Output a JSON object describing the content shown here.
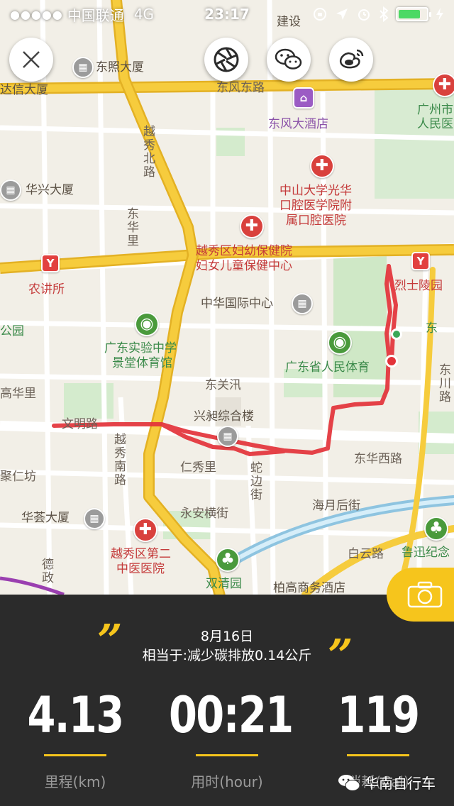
{
  "status_bar": {
    "signal": "●●●●●",
    "carrier": "中国联通",
    "network": "4G",
    "time": "23:17"
  },
  "map": {
    "labels": {
      "jianshe": "建设",
      "dongzhao": "东照大厦",
      "daxin": "达信大厦",
      "dongfeng_road": "东风东路",
      "dongfeng_hotel": "东风大酒店",
      "gz_city": "广州市",
      "people_court": "人民医",
      "yuexiu_north": "越秀北路",
      "huaxing": "华兴大厦",
      "zhongshan_1": "中山大学光华",
      "zhongshan_2": "口腔医学院附",
      "zhongshan_3": "属口腔医院",
      "donghua": "东华里",
      "maternity_1": "越秀区妇幼保健院",
      "maternity_2": "妇女儿童保健中心",
      "nongjiang": "农讲所",
      "martyrs": "烈士陵园",
      "zhonghua": "中华国际中心",
      "gongyuan": "公园",
      "dong": "东",
      "gd_exp_1": "广东实验中学",
      "gd_exp_2": "景堂体育馆",
      "gd_stadium": "广东省人民体育",
      "dongguan": "东关汛",
      "huali": "高华里",
      "wenming": "文明路",
      "xingzu": "兴昶综合楼",
      "yuexiu_south": "越秀南路",
      "dongchuan": "东川路",
      "donghua_west": "东华西路",
      "jiangren": "聚仁坊",
      "renxiu": "仁秀里",
      "dongdian": "东",
      "duobian": "蛇边街",
      "huaying": "华荟大厦",
      "yongan": "永安横街",
      "haiyue": "海月后街",
      "hospital2_1": "越秀区第二",
      "hospital2_2": "中医医院",
      "baiyun": "白云路",
      "luxun": "鲁迅纪念",
      "shuangqing": "双清园",
      "debo": "德政",
      "hotel_bottom": "柏高商务酒店"
    }
  },
  "controls": {
    "close": "close",
    "aperture": "aperture",
    "wechat": "wechat",
    "weibo": "weibo",
    "camera": "camera"
  },
  "summary": {
    "date": "8月16日",
    "text": "相当于:减少碳排放0.14公斤"
  },
  "stats": {
    "distance": {
      "value": "4.13",
      "label": "里程(km)"
    },
    "duration": {
      "value": "00:21",
      "label": "用时(hour)"
    },
    "calories": {
      "value": "119",
      "label": "消耗(Cal)"
    }
  },
  "watermark": {
    "text": "华南自行车"
  },
  "colors": {
    "accent": "#f6c51c",
    "route": "#e3333a",
    "panel": "#2b2b2b",
    "main_road": "#f3c230"
  }
}
